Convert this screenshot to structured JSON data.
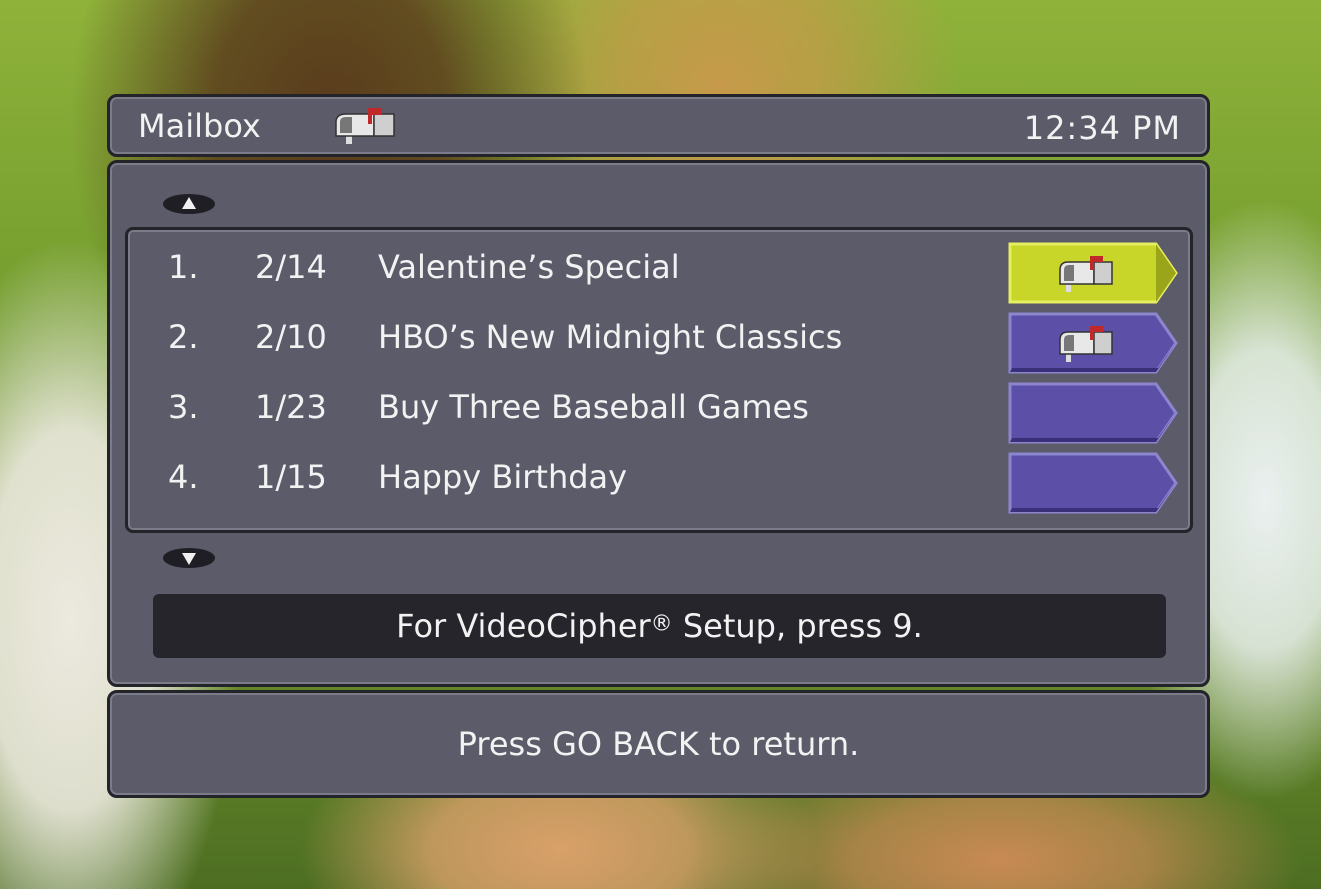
{
  "header": {
    "title": "Mailbox",
    "title_icon": "mailbox-icon",
    "time": "12:34 PM"
  },
  "list": {
    "scroll_up_icon": "arrow-up-icon",
    "scroll_down_icon": "arrow-down-icon",
    "items": [
      {
        "num": "1.",
        "date": "2/14",
        "subject": "Valentine’s Special",
        "has_mail_icon": true,
        "selected": true
      },
      {
        "num": "2.",
        "date": "2/10",
        "subject": "HBO’s New Midnight Classics",
        "has_mail_icon": true,
        "selected": false
      },
      {
        "num": "3.",
        "date": "1/23",
        "subject": "Buy Three Baseball Games",
        "has_mail_icon": false,
        "selected": false
      },
      {
        "num": "4.",
        "date": "1/15",
        "subject": "Happy Birthday",
        "has_mail_icon": false,
        "selected": false
      }
    ]
  },
  "info": {
    "prefix": "For VideoCipher",
    "reg": "®",
    "suffix": " Setup, press 9."
  },
  "footer": {
    "text": "Press GO BACK to return."
  },
  "colors": {
    "panel": "#5b5b6a",
    "selected_tab": "#c8d62a",
    "tab": "#5b4fa8"
  }
}
